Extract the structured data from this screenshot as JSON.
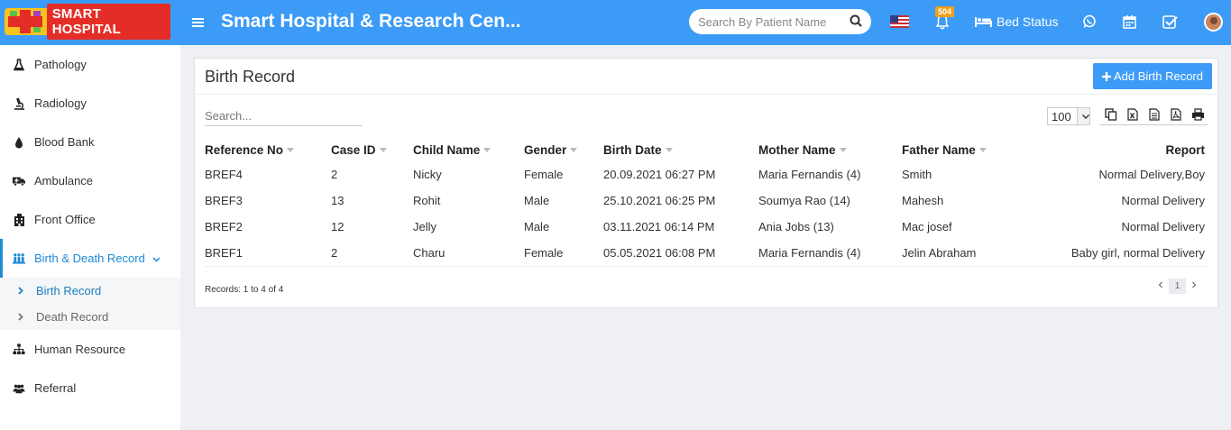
{
  "header": {
    "logo_text": "SMART HOSPITAL",
    "title": "Smart Hospital & Research Cen...",
    "search_placeholder": "Search By Patient Name",
    "notification_count": "504",
    "bed_status_label": "Bed Status",
    "accent_color": "#3c9bf6"
  },
  "sidebar": {
    "items": [
      {
        "label": "Pathology",
        "icon": "flask-icon"
      },
      {
        "label": "Radiology",
        "icon": "microscope-icon"
      },
      {
        "label": "Blood Bank",
        "icon": "drop-icon"
      },
      {
        "label": "Ambulance",
        "icon": "ambulance-icon"
      },
      {
        "label": "Front Office",
        "icon": "building-icon"
      },
      {
        "label": "Birth & Death Record",
        "icon": "family-icon"
      },
      {
        "label": "Human Resource",
        "icon": "sitemap-icon"
      },
      {
        "label": "Referral",
        "icon": "users-icon"
      }
    ],
    "sub_items": [
      {
        "label": "Birth Record"
      },
      {
        "label": "Death Record"
      }
    ]
  },
  "panel": {
    "title": "Birth Record",
    "add_button": "Add Birth Record",
    "search_placeholder": "Search...",
    "page_size": "100",
    "columns": [
      "Reference No",
      "Case ID",
      "Child Name",
      "Gender",
      "Birth Date",
      "Mother Name",
      "Father Name",
      "Report"
    ],
    "rows": [
      [
        "BREF4",
        "2",
        "Nicky",
        "Female",
        "20.09.2021 06:27 PM",
        "Maria Fernandis (4)",
        "Smith",
        "Normal Delivery,Boy"
      ],
      [
        "BREF3",
        "13",
        "Rohit",
        "Male",
        "25.10.2021 06:25 PM",
        "Soumya Rao (14)",
        "Mahesh",
        "Normal Delivery"
      ],
      [
        "BREF2",
        "12",
        "Jelly",
        "Male",
        "03.11.2021 06:14 PM",
        "Ania Jobs (13)",
        "Mac josef",
        "Normal Delivery"
      ],
      [
        "BREF1",
        "2",
        "Charu",
        "Female",
        "05.05.2021 06:08 PM",
        "Maria Fernandis (4)",
        "Jelin Abraham",
        "Baby girl, normal Delivery"
      ]
    ],
    "records_info": "Records: 1 to 4 of 4",
    "current_page": "1"
  }
}
